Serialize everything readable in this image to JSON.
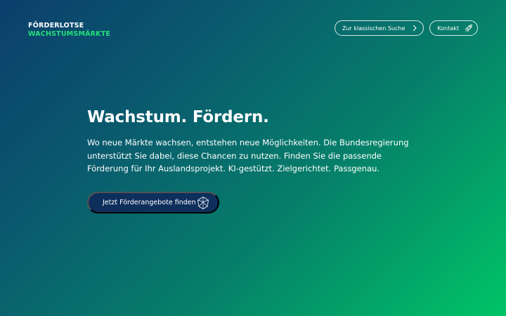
{
  "logo": {
    "line1": "FÖRDERLOTSE",
    "line2": "WACHSTUMSMÄRKTE"
  },
  "header": {
    "classic_search_label": "Zur klassischen Suche",
    "contact_label": "Kontakt"
  },
  "hero": {
    "title": "Wachstum. Fördern.",
    "text": "Wo neue Märkte wachsen, entstehen neue Möglichkeiten. Die Bundesregierung unterstützt Sie dabei, diese Chancen zu nutzen. Finden Sie die passende Förderung für Ihr Auslandsprojekt. KI-gestützt. Zielgerichtet. Passgenau.",
    "cta_label": "Jetzt Förderangebote finden"
  },
  "icons": {
    "classic_search": "chevron-right-icon",
    "contact": "rocket-icon",
    "cta": "polyhedron-icon"
  },
  "colors": {
    "brand_green": "#23e07a",
    "cta_background": "#0e2f5c",
    "gradient_start": "#0b3f6c",
    "gradient_end": "#00c466"
  }
}
